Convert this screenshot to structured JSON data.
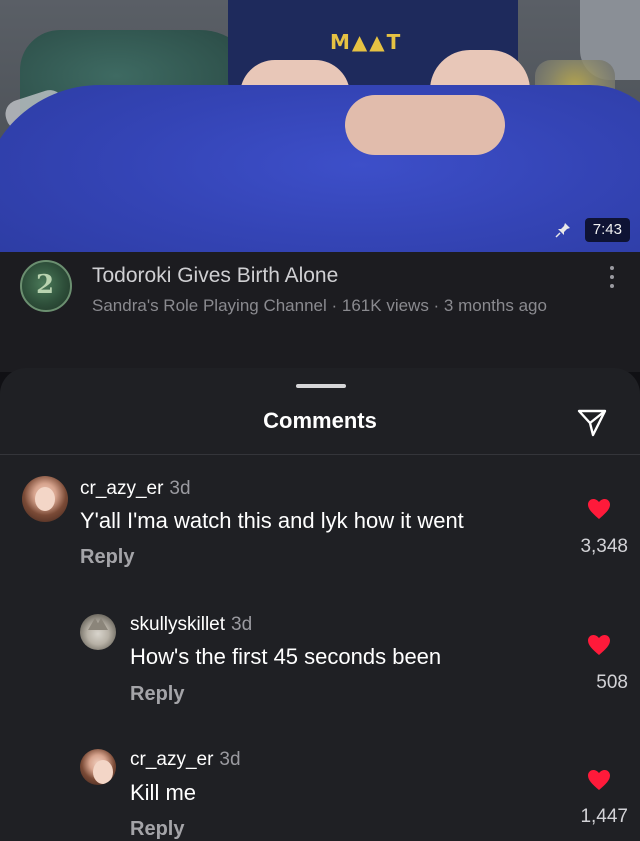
{
  "video": {
    "duration": "7:43",
    "shirt_text": "M▲▲T",
    "title": "Todoroki Gives Birth Alone",
    "subtitle": "Sandra's Role Playing Channel · 161K views · 3 months ago",
    "channel_icon_glyph": "2"
  },
  "sheet": {
    "title": "Comments"
  },
  "comments": [
    {
      "user": "cr_azy_er",
      "time": "3d",
      "text": "Y'all I'ma watch this and lyk how it went",
      "reply": "Reply",
      "likes": "3,348",
      "avatar": "girl"
    },
    {
      "user": "skullyskillet",
      "time": "3d",
      "text": "How's the first 45 seconds been",
      "reply": "Reply",
      "likes": "508",
      "avatar": "cat"
    },
    {
      "user": "cr_azy_er",
      "time": "3d",
      "text": "Kill me",
      "reply": "Reply",
      "likes": "1,447",
      "avatar": "girl"
    }
  ],
  "colors": {
    "heart": "#ff1a3a",
    "sheet_bg": "#1f2024",
    "blanket": "#3444b5"
  },
  "icons": [
    "pin-icon",
    "more-vertical-icon",
    "send-icon",
    "heart-icon"
  ]
}
